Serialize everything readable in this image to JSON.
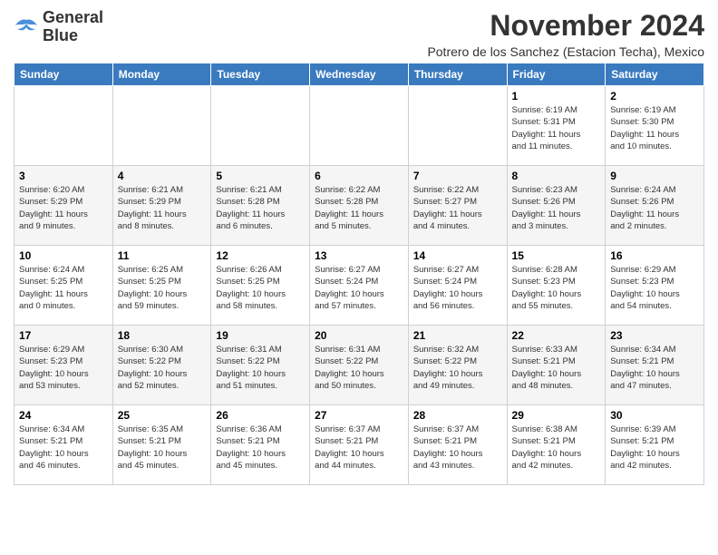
{
  "logo": {
    "line1": "General",
    "line2": "Blue"
  },
  "title": "November 2024",
  "subtitle": "Potrero de los Sanchez (Estacion Techa), Mexico",
  "days_header": [
    "Sunday",
    "Monday",
    "Tuesday",
    "Wednesday",
    "Thursday",
    "Friday",
    "Saturday"
  ],
  "weeks": [
    [
      {
        "day": "",
        "info": ""
      },
      {
        "day": "",
        "info": ""
      },
      {
        "day": "",
        "info": ""
      },
      {
        "day": "",
        "info": ""
      },
      {
        "day": "",
        "info": ""
      },
      {
        "day": "1",
        "info": "Sunrise: 6:19 AM\nSunset: 5:31 PM\nDaylight: 11 hours\nand 11 minutes."
      },
      {
        "day": "2",
        "info": "Sunrise: 6:19 AM\nSunset: 5:30 PM\nDaylight: 11 hours\nand 10 minutes."
      }
    ],
    [
      {
        "day": "3",
        "info": "Sunrise: 6:20 AM\nSunset: 5:29 PM\nDaylight: 11 hours\nand 9 minutes."
      },
      {
        "day": "4",
        "info": "Sunrise: 6:21 AM\nSunset: 5:29 PM\nDaylight: 11 hours\nand 8 minutes."
      },
      {
        "day": "5",
        "info": "Sunrise: 6:21 AM\nSunset: 5:28 PM\nDaylight: 11 hours\nand 6 minutes."
      },
      {
        "day": "6",
        "info": "Sunrise: 6:22 AM\nSunset: 5:28 PM\nDaylight: 11 hours\nand 5 minutes."
      },
      {
        "day": "7",
        "info": "Sunrise: 6:22 AM\nSunset: 5:27 PM\nDaylight: 11 hours\nand 4 minutes."
      },
      {
        "day": "8",
        "info": "Sunrise: 6:23 AM\nSunset: 5:26 PM\nDaylight: 11 hours\nand 3 minutes."
      },
      {
        "day": "9",
        "info": "Sunrise: 6:24 AM\nSunset: 5:26 PM\nDaylight: 11 hours\nand 2 minutes."
      }
    ],
    [
      {
        "day": "10",
        "info": "Sunrise: 6:24 AM\nSunset: 5:25 PM\nDaylight: 11 hours\nand 0 minutes."
      },
      {
        "day": "11",
        "info": "Sunrise: 6:25 AM\nSunset: 5:25 PM\nDaylight: 10 hours\nand 59 minutes."
      },
      {
        "day": "12",
        "info": "Sunrise: 6:26 AM\nSunset: 5:25 PM\nDaylight: 10 hours\nand 58 minutes."
      },
      {
        "day": "13",
        "info": "Sunrise: 6:27 AM\nSunset: 5:24 PM\nDaylight: 10 hours\nand 57 minutes."
      },
      {
        "day": "14",
        "info": "Sunrise: 6:27 AM\nSunset: 5:24 PM\nDaylight: 10 hours\nand 56 minutes."
      },
      {
        "day": "15",
        "info": "Sunrise: 6:28 AM\nSunset: 5:23 PM\nDaylight: 10 hours\nand 55 minutes."
      },
      {
        "day": "16",
        "info": "Sunrise: 6:29 AM\nSunset: 5:23 PM\nDaylight: 10 hours\nand 54 minutes."
      }
    ],
    [
      {
        "day": "17",
        "info": "Sunrise: 6:29 AM\nSunset: 5:23 PM\nDaylight: 10 hours\nand 53 minutes."
      },
      {
        "day": "18",
        "info": "Sunrise: 6:30 AM\nSunset: 5:22 PM\nDaylight: 10 hours\nand 52 minutes."
      },
      {
        "day": "19",
        "info": "Sunrise: 6:31 AM\nSunset: 5:22 PM\nDaylight: 10 hours\nand 51 minutes."
      },
      {
        "day": "20",
        "info": "Sunrise: 6:31 AM\nSunset: 5:22 PM\nDaylight: 10 hours\nand 50 minutes."
      },
      {
        "day": "21",
        "info": "Sunrise: 6:32 AM\nSunset: 5:22 PM\nDaylight: 10 hours\nand 49 minutes."
      },
      {
        "day": "22",
        "info": "Sunrise: 6:33 AM\nSunset: 5:21 PM\nDaylight: 10 hours\nand 48 minutes."
      },
      {
        "day": "23",
        "info": "Sunrise: 6:34 AM\nSunset: 5:21 PM\nDaylight: 10 hours\nand 47 minutes."
      }
    ],
    [
      {
        "day": "24",
        "info": "Sunrise: 6:34 AM\nSunset: 5:21 PM\nDaylight: 10 hours\nand 46 minutes."
      },
      {
        "day": "25",
        "info": "Sunrise: 6:35 AM\nSunset: 5:21 PM\nDaylight: 10 hours\nand 45 minutes."
      },
      {
        "day": "26",
        "info": "Sunrise: 6:36 AM\nSunset: 5:21 PM\nDaylight: 10 hours\nand 45 minutes."
      },
      {
        "day": "27",
        "info": "Sunrise: 6:37 AM\nSunset: 5:21 PM\nDaylight: 10 hours\nand 44 minutes."
      },
      {
        "day": "28",
        "info": "Sunrise: 6:37 AM\nSunset: 5:21 PM\nDaylight: 10 hours\nand 43 minutes."
      },
      {
        "day": "29",
        "info": "Sunrise: 6:38 AM\nSunset: 5:21 PM\nDaylight: 10 hours\nand 42 minutes."
      },
      {
        "day": "30",
        "info": "Sunrise: 6:39 AM\nSunset: 5:21 PM\nDaylight: 10 hours\nand 42 minutes."
      }
    ]
  ]
}
